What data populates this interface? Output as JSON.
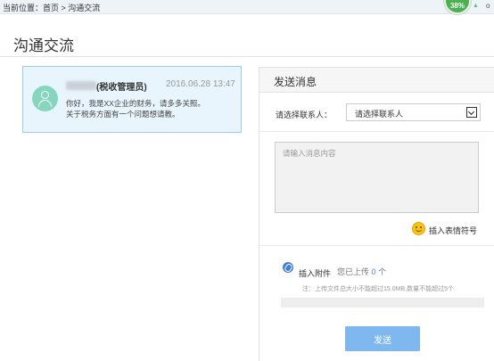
{
  "breadcrumb": {
    "prefix": "当前位置：",
    "home": "首页",
    "separator": " > ",
    "current": "沟通交流"
  },
  "system_widget": {
    "text": "38%",
    "tray_letter": "o",
    "color": "#4caf50"
  },
  "page": {
    "title": "沟通交流"
  },
  "messages": [
    {
      "sender_role": "(税收管理员)",
      "time": "2016.06.28 13:47",
      "lines": [
        "你好，我是XX企业的财务，请多多关照。",
        "关于税务方面有一个问题想请教。"
      ]
    }
  ],
  "send_panel": {
    "title": "发送消息",
    "contact_label": "请选择联系人：",
    "contact_selected": "请选择联系人",
    "message_placeholder": "请输入消息内容",
    "emoji_label": "插入表情符号",
    "attachment_label": "插入附件",
    "upload_prefix": "您已上传",
    "upload_count": "0",
    "upload_suffix": "个",
    "upload_note": "注：上传文件总大小不能超过15.0MB,数量不能超过5个",
    "send_label": "发送"
  },
  "colors": {
    "card_bg": "#e9f5fd",
    "card_border": "#9ccbeb",
    "avatar": "#86d6bd",
    "send_button": "#7fb8ef",
    "link_blue": "#3a8ee6"
  },
  "icons": [
    "user-avatar-icon",
    "dropdown-arrow-icon",
    "smiley-icon",
    "paperclip-icon"
  ]
}
